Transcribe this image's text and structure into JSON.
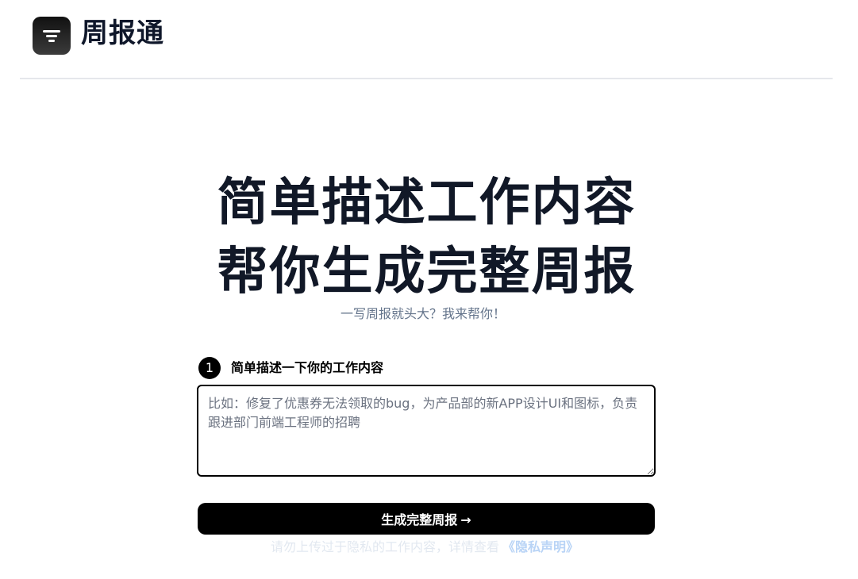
{
  "header": {
    "logo_icon": "filter-lines-icon",
    "brand": "周报通"
  },
  "hero": {
    "line1": "简单描述工作内容",
    "line2": "帮你生成完整周报",
    "subtitle": "一写周报就头大？我来帮你！"
  },
  "step1": {
    "number": "1",
    "label": "简单描述一下你的工作内容"
  },
  "input": {
    "value": "",
    "placeholder": "比如：修复了优惠券无法领取的bug，为产品部的新APP设计UI和图标，负责跟进部门前端工程师的招聘"
  },
  "cta": {
    "label": "生成完整周报",
    "arrow": "→",
    "arrow_icon": "arrow-right-icon"
  },
  "notice": {
    "text": "请勿上传过于隐私的工作内容，详情查看",
    "link": "《隐私声明》"
  },
  "colors": {
    "primary": "#000000",
    "text_dark": "#111827",
    "muted": "#64748b",
    "link": "#b9d4f6",
    "divider": "#e5e7eb"
  }
}
